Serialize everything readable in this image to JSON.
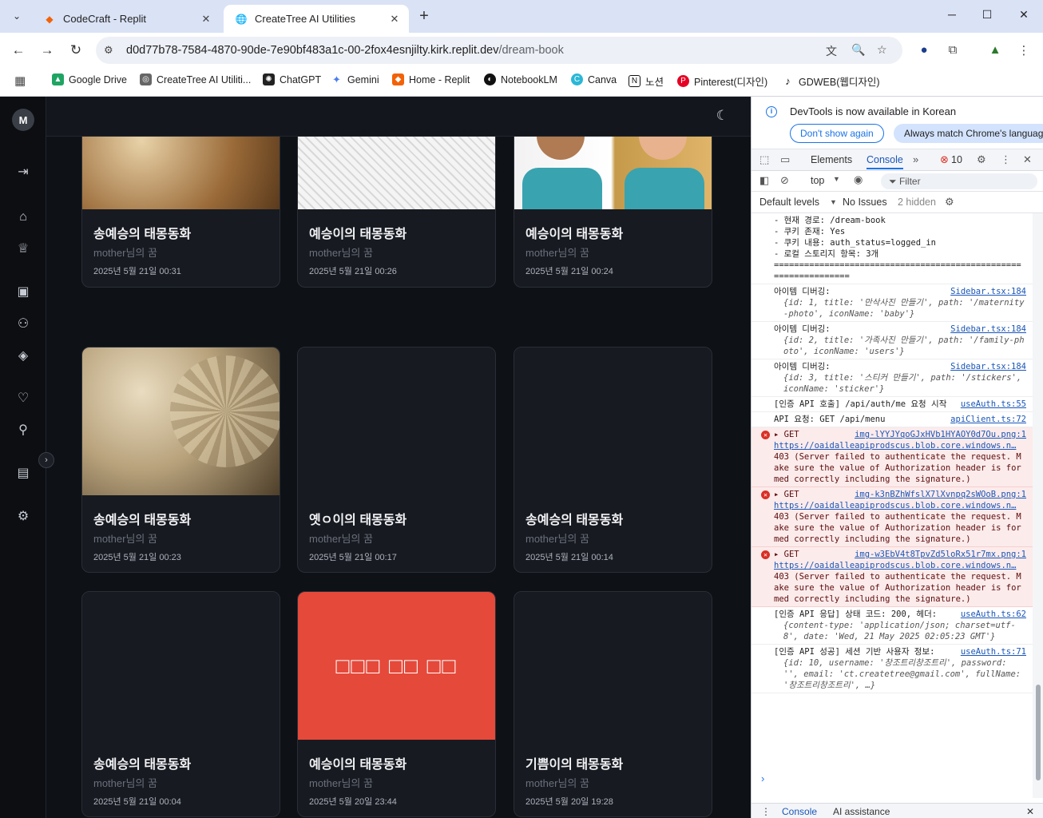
{
  "browser": {
    "tabs": [
      {
        "title": "CodeCraft - Replit",
        "icon": "replit-icon"
      },
      {
        "title": "CreateTree AI Utilities",
        "icon": "globe-icon"
      }
    ],
    "url_host": "d0d77b78-7584-4870-90de-7e90bf483a1c-00-2fox4esnjilty.kirk.replit.dev",
    "url_path": "/dream-book",
    "bookmarks": [
      "Google Drive",
      "CreateTree AI Utiliti...",
      "ChatGPT",
      "Gemini",
      "Home - Replit",
      "NotebookLM",
      "Canva",
      "노션",
      "Pinterest(디자인)",
      "GDWEB(웹디자인)"
    ]
  },
  "app": {
    "avatar_initial": "M",
    "cards": [
      {
        "title": "송예승의 태몽동화",
        "subtitle": "mother님의 꿈",
        "date": "2025년 5월 21일 00:31",
        "image": "family-illustration-sepia"
      },
      {
        "title": "예승이의 태몽동화",
        "subtitle": "mother님의 꿈",
        "date": "2025년 5월 21일 00:26",
        "image": "family-lineart"
      },
      {
        "title": "예승이의 태몽동화",
        "subtitle": "mother님의 꿈",
        "date": "2025년 5월 21일 00:24",
        "image": "cartoon-children-meal"
      },
      {
        "title": "송예승의 태몽동화",
        "subtitle": "mother님의 꿈",
        "date": "2025년 5월 21일 00:23",
        "image": "vintage-family-photo"
      },
      {
        "title": "옛ㅇ이의 태몽동화",
        "subtitle": "mother님의 꿈",
        "date": "2025년 5월 21일 00:17",
        "image": "none"
      },
      {
        "title": "송예승의 태몽동화",
        "subtitle": "mother님의 꿈",
        "date": "2025년 5월 21일 00:14",
        "image": "none"
      },
      {
        "title": "송예승의 태몽동화",
        "subtitle": "mother님의 꿈",
        "date": "2025년 5월 21일 00:04",
        "image": "none"
      },
      {
        "title": "예승이의 태몽동화",
        "subtitle": "mother님의 꿈",
        "date": "2025년 5월 20일 23:44",
        "image": "error-placeholder",
        "placeholder_text": "□□□ □□ □□"
      },
      {
        "title": "기쁨이의 태몽동화",
        "subtitle": "mother님의 꿈",
        "date": "2025년 5월 20일 19:28",
        "image": "none"
      }
    ]
  },
  "devtools": {
    "info": "DevTools is now available in Korean",
    "dont_show": "Don't show again",
    "always_match": "Always match Chrome's languag",
    "tabs": [
      "Elements",
      "Console"
    ],
    "error_count": "10",
    "context": "top",
    "filter_placeholder": "Filter",
    "levels": "Default levels",
    "issues": "No Issues",
    "hidden": "2 hidden",
    "drawer_console": "Console",
    "drawer_ai": "AI assistance",
    "logs": {
      "pre": "- 현재 경로: /dream-book\n- 쿠키 존재: Yes\n- 쿠키 내용: auth_status=logged_in\n- 로컬 스토리지 항목: 3개\n================================================================",
      "item1_msg": "아이템 디버깅:",
      "item1_src": "Sidebar.tsx:184",
      "item1_obj": "{id: 1, title: '만삭사진 만들기', path: '/maternity-photo', iconName: 'baby'}",
      "item2_msg": "아이템 디버깅:",
      "item2_src": "Sidebar.tsx:184",
      "item2_obj": "{id: 2, title: '가족사진 만들기', path: '/family-photo', iconName: 'users'}",
      "item3_msg": "아이템 디버깅:",
      "item3_src": "Sidebar.tsx:184",
      "item3_obj": "{id: 3, title: '스티커 만들기', path: '/stickers', iconName: 'sticker'}",
      "auth_msg": "[인증 API 호출] /api/auth/me 요청 시작",
      "auth_src": "useAuth.ts:55",
      "api_msg": "API 요청: GET /api/menu",
      "api_src": "apiClient.ts:72",
      "err1_file": "img-lYYJYqoGJxHVb1HYAOY0d7Ou.png:1",
      "err2_file": "img-k3nBZhWfslX7lXvnpq2sWOoB.png:1",
      "err3_file": "img-w3EbV4t8TpvZd5loRx51r7mx.png:1",
      "err_url": "https://oaidalleapiprodscus.blob.core.windows.n…",
      "err_get": "GET",
      "err_text": "403 (Server failed to authenticate the request. Make sure the value of Authorization header is formed correctly including the signature.)",
      "resp_msg": "[인증 API 응답] 상태 코드: 200, 헤더:",
      "resp_src": "useAuth.ts:62",
      "resp_obj": "{content-type: 'application/json; charset=utf-8', date: 'Wed, 21 May 2025 02:05:23 GMT'}",
      "ok_msg": "[인증 API 성공] 세션 기반 사용자 정보:",
      "ok_src": "useAuth.ts:71",
      "ok_obj": "{id: 10, username: '창조트리창조트리', password: '', email: 'ct.createtree@gmail.com', fullName: '창조트리창조트리', …}"
    }
  },
  "colors": {
    "error_card": "#e5493a",
    "accent": "#1a73e8"
  }
}
